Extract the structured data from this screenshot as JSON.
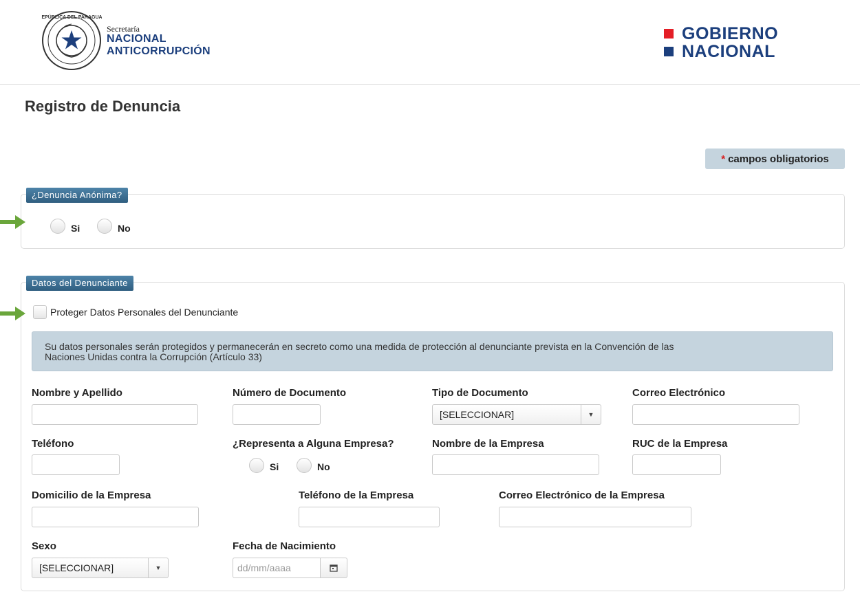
{
  "header": {
    "sec_small": "Secretaría",
    "sec_line1": "NACIONAL",
    "sec_line2": "ANTICORRUPCIÓN",
    "gob_line1": "GOBIERNO",
    "gob_line2": "NACIONAL",
    "seal_icon": "paraguay-seal-icon",
    "seal_text": "REPÚBLICA DEL PARAGUAY"
  },
  "page": {
    "title": "Registro de Denuncia",
    "required_star": "*",
    "required_label": "campos obligatorios"
  },
  "anonymous": {
    "legend": "¿Denuncia Anónima?",
    "yes": "Si",
    "no": "No"
  },
  "complainant": {
    "legend": "Datos del Denunciante",
    "protect_label": "Proteger Datos Personales del Denunciante",
    "info_line1": "Su datos personales serán protegidos y permanecerán en secreto como una medida de protección al denunciante prevista en la Convención de las",
    "info_line2": "Naciones Unidas contra la Corrupción (Artículo 33)",
    "fields": {
      "name": "Nombre y Apellido",
      "doc_number": "Número de Documento",
      "doc_type": "Tipo de Documento",
      "email": "Correo Electrónico",
      "phone": "Teléfono",
      "represents": "¿Representa a Alguna Empresa?",
      "company_name": "Nombre de la Empresa",
      "company_ruc": "RUC de la Empresa",
      "company_address": "Domicilio de la Empresa",
      "company_phone": "Teléfono de la Empresa",
      "company_email": "Correo Electrónico de la Empresa",
      "sex": "Sexo",
      "birth_date": "Fecha de Nacimiento"
    },
    "doc_type_value": "[SELECCIONAR]",
    "sex_value": "[SELECCIONAR]",
    "birth_date_placeholder": "dd/mm/aaaa",
    "represents_yes": "Si",
    "represents_no": "No"
  },
  "colors": {
    "brand_blue": "#1c3f7d",
    "legend_blue": "#3a6f93",
    "info_bg": "#c5d4de",
    "arrow_green": "#6aa63b",
    "required_red": "#d81c1c",
    "gob_red": "#e41e26"
  }
}
